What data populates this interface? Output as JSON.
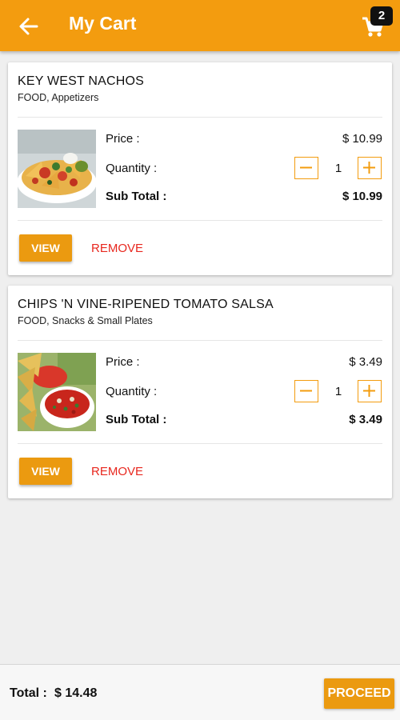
{
  "app": {
    "title": "My Cart",
    "cart_count": "2",
    "accent_color": "#f39c0f"
  },
  "items": [
    {
      "name": "KEY WEST NACHOS",
      "category": "FOOD, Appetizers",
      "price_label": "Price :",
      "price": "$ 10.99",
      "quantity_label": "Quantity :",
      "quantity": "1",
      "subtotal_label": "Sub Total :",
      "subtotal": "$ 10.99",
      "view_label": "VIEW",
      "remove_label": "REMOVE",
      "image": "nachos-photo"
    },
    {
      "name": "CHIPS 'N VINE-RIPENED TOMATO SALSA",
      "category": "FOOD, Snacks & Small Plates",
      "price_label": "Price :",
      "price": "$ 3.49",
      "quantity_label": "Quantity :",
      "quantity": "1",
      "subtotal_label": "Sub Total :",
      "subtotal": "$ 3.49",
      "view_label": "VIEW",
      "remove_label": "REMOVE",
      "image": "chips-salsa-photo"
    }
  ],
  "footer": {
    "total_label": "Total :",
    "total_value": "$ 14.48",
    "proceed_label": "PROCEED"
  }
}
